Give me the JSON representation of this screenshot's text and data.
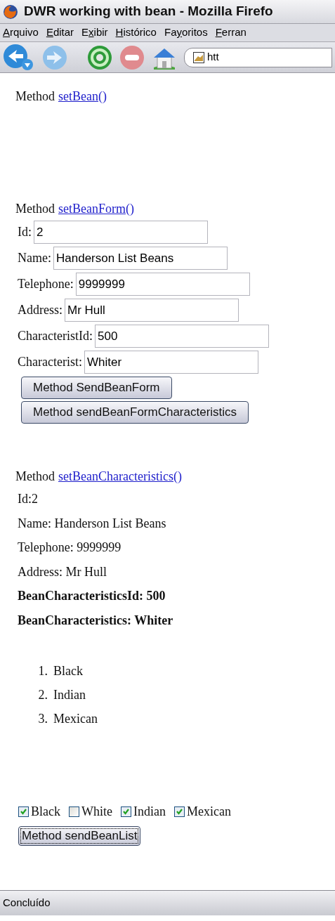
{
  "window": {
    "title": "DWR working with bean - Mozilla Firefo"
  },
  "menu": [
    {
      "parts": [
        {
          "text": "A",
          "underlined": true
        },
        {
          "text": "rquivo",
          "underlined": false
        }
      ]
    },
    {
      "parts": [
        {
          "text": "E",
          "underlined": true
        },
        {
          "text": "ditar",
          "underlined": false
        }
      ]
    },
    {
      "parts": [
        {
          "text": "E",
          "underlined": false
        },
        {
          "text": "x",
          "underlined": true
        },
        {
          "text": "ibir",
          "underlined": false
        }
      ]
    },
    {
      "parts": [
        {
          "text": "H",
          "underlined": true
        },
        {
          "text": "istórico",
          "underlined": false
        }
      ]
    },
    {
      "parts": [
        {
          "text": "Fa",
          "underlined": false
        },
        {
          "text": "y",
          "underlined": true
        },
        {
          "text": "oritos",
          "underlined": false
        }
      ]
    },
    {
      "parts": [
        {
          "text": "F",
          "underlined": true
        },
        {
          "text": "erran",
          "underlined": false
        }
      ]
    }
  ],
  "address_bar": {
    "value": "htt"
  },
  "set_bean": {
    "label": "Method",
    "link": "setBean()"
  },
  "set_bean_form": {
    "label": "Method",
    "link": "setBeanForm()",
    "fields": [
      {
        "label": "Id:",
        "value": "2"
      },
      {
        "label": "Name:",
        "value": "Handerson List Beans"
      },
      {
        "label": "Telephone:",
        "value": "9999999"
      },
      {
        "label": "Address:",
        "value": "Mr Hull"
      },
      {
        "label": "CharacteristId:",
        "value": "500"
      },
      {
        "label": "Characterist:",
        "value": "Whiter"
      }
    ],
    "buttons": [
      {
        "label": "Method SendBeanForm",
        "focused": false
      },
      {
        "label": "Method sendBeanFormCharacteristics",
        "focused": false
      }
    ]
  },
  "set_bean_characteristics": {
    "label": "Method",
    "link": "setBeanCharacteristics()",
    "lines": [
      {
        "text": "Id:2",
        "bold": false
      },
      {
        "text": "Name: Handerson List Beans",
        "bold": false
      },
      {
        "text": "Telephone: 9999999",
        "bold": false
      },
      {
        "text": "Address: Mr Hull",
        "bold": false
      },
      {
        "text": "BeanCharacteristicsId: 500",
        "bold": true
      },
      {
        "text": "BeanCharacteristics: Whiter",
        "bold": true
      }
    ],
    "list": [
      {
        "number": "1.",
        "text": "Black"
      },
      {
        "number": "2.",
        "text": "Indian"
      },
      {
        "number": "3.",
        "text": "Mexican"
      }
    ]
  },
  "checkboxes": [
    {
      "label": "Black",
      "checked": true
    },
    {
      "label": "White",
      "checked": false
    },
    {
      "label": "Indian",
      "checked": true
    },
    {
      "label": "Mexican",
      "checked": true
    }
  ],
  "send_list_button": {
    "label": "Method sendBeanList",
    "focused": true
  },
  "status_bar": {
    "text": "Concluído"
  }
}
